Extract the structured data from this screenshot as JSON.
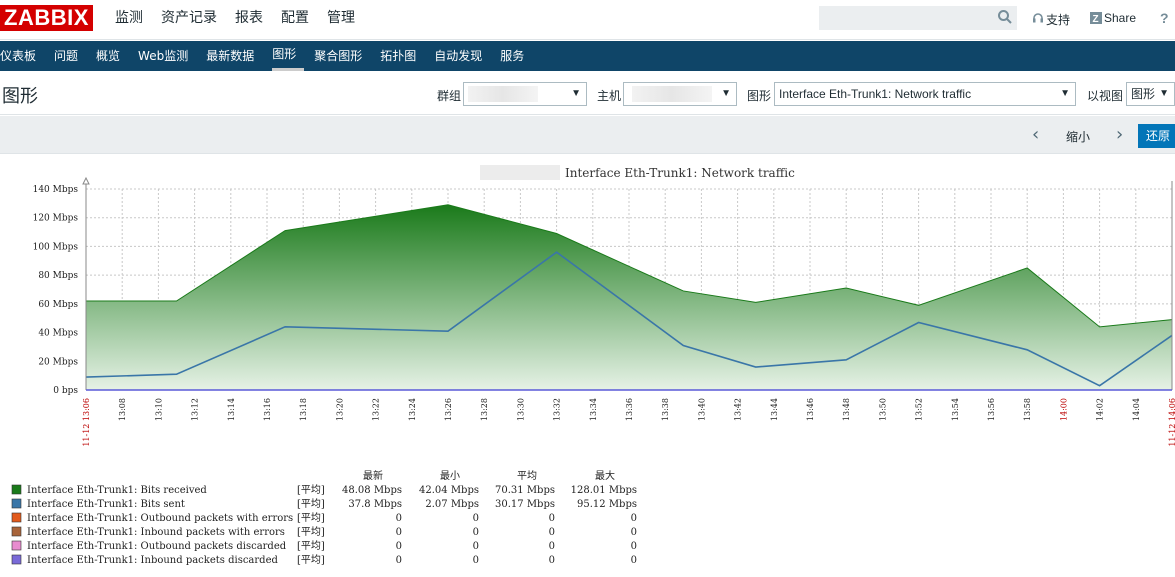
{
  "app": {
    "logo": "ZABBIX"
  },
  "main_nav": [
    "监测",
    "资产记录",
    "报表",
    "配置",
    "管理"
  ],
  "top_links": {
    "support": "支持",
    "share": "Share"
  },
  "sub_nav": [
    "仪表板",
    "问题",
    "概览",
    "Web监测",
    "最新数据",
    "图形",
    "聚合图形",
    "拓扑图",
    "自动发现",
    "服务"
  ],
  "sub_nav_active": 5,
  "page": {
    "title": "图形",
    "filter": {
      "group_label": "群组",
      "host_label": "主机",
      "graph_label": "图形",
      "graph_value": "Interface Eth-Trunk1: Network traffic",
      "view_label": "以视图",
      "view_value": "图形"
    },
    "controls": {
      "zoom_out": "缩小",
      "reset": "还原"
    }
  },
  "colors": {
    "received": "#1a7a1a",
    "sent": "#3a76a8",
    "accent": "#0f4568"
  },
  "chart_data": {
    "type": "area",
    "title": "Interface Eth-Trunk1: Network traffic",
    "ylim": [
      0,
      140
    ],
    "yticks": [
      "0 bps",
      "20 Mbps",
      "40 Mbps",
      "60 Mbps",
      "80 Mbps",
      "100 Mbps",
      "120 Mbps",
      "140 Mbps"
    ],
    "x_start_label": "11-12 13:06",
    "x_end_label": "11-12 14:06",
    "xticks": [
      "13:08",
      "13:10",
      "13:12",
      "13:14",
      "13:16",
      "13:18",
      "13:20",
      "13:22",
      "13:24",
      "13:26",
      "13:28",
      "13:30",
      "13:32",
      "13:34",
      "13:36",
      "13:38",
      "13:40",
      "13:42",
      "13:44",
      "13:46",
      "13:48",
      "13:50",
      "13:52",
      "13:54",
      "13:56",
      "13:58",
      "14:00",
      "14:02",
      "14:04",
      "14:06"
    ],
    "x_minutes": [
      0,
      5,
      11,
      20,
      26,
      33,
      37,
      42,
      46,
      52,
      56,
      60
    ],
    "series": [
      {
        "name": "Interface Eth-Trunk1: Bits received",
        "values": [
          62,
          62,
          111,
          129,
          109,
          69,
          61,
          71,
          59,
          85,
          44,
          49
        ]
      },
      {
        "name": "Interface Eth-Trunk1: Bits sent",
        "values": [
          9,
          11,
          44,
          41,
          96,
          31,
          16,
          21,
          47,
          28,
          3,
          38
        ]
      }
    ],
    "legend_headers": [
      "最新",
      "最小",
      "平均",
      "最大"
    ],
    "legend": [
      {
        "name": "Interface Eth-Trunk1: Bits received",
        "func": "[平均]",
        "last": "48.08 Mbps",
        "min": "42.04 Mbps",
        "avg": "70.31 Mbps",
        "max": "128.01 Mbps",
        "color": "#1a7a1a"
      },
      {
        "name": "Interface Eth-Trunk1: Bits sent",
        "func": "[平均]",
        "last": "37.8 Mbps",
        "min": "2.07 Mbps",
        "avg": "30.17 Mbps",
        "max": "95.12 Mbps",
        "color": "#3a76a8"
      },
      {
        "name": "Interface Eth-Trunk1: Outbound packets with errors",
        "func": "[平均]",
        "last": "0",
        "min": "0",
        "avg": "0",
        "max": "0",
        "color": "#e25a1c"
      },
      {
        "name": "Interface Eth-Trunk1: Inbound packets with errors",
        "func": "[平均]",
        "last": "0",
        "min": "0",
        "avg": "0",
        "max": "0",
        "color": "#a8643a"
      },
      {
        "name": "Interface Eth-Trunk1: Outbound packets discarded",
        "func": "[平均]",
        "last": "0",
        "min": "0",
        "avg": "0",
        "max": "0",
        "color": "#e88ccf"
      },
      {
        "name": "Interface Eth-Trunk1: Inbound packets discarded",
        "func": "[平均]",
        "last": "0",
        "min": "0",
        "avg": "0",
        "max": "0",
        "color": "#7a6ad8"
      }
    ]
  }
}
